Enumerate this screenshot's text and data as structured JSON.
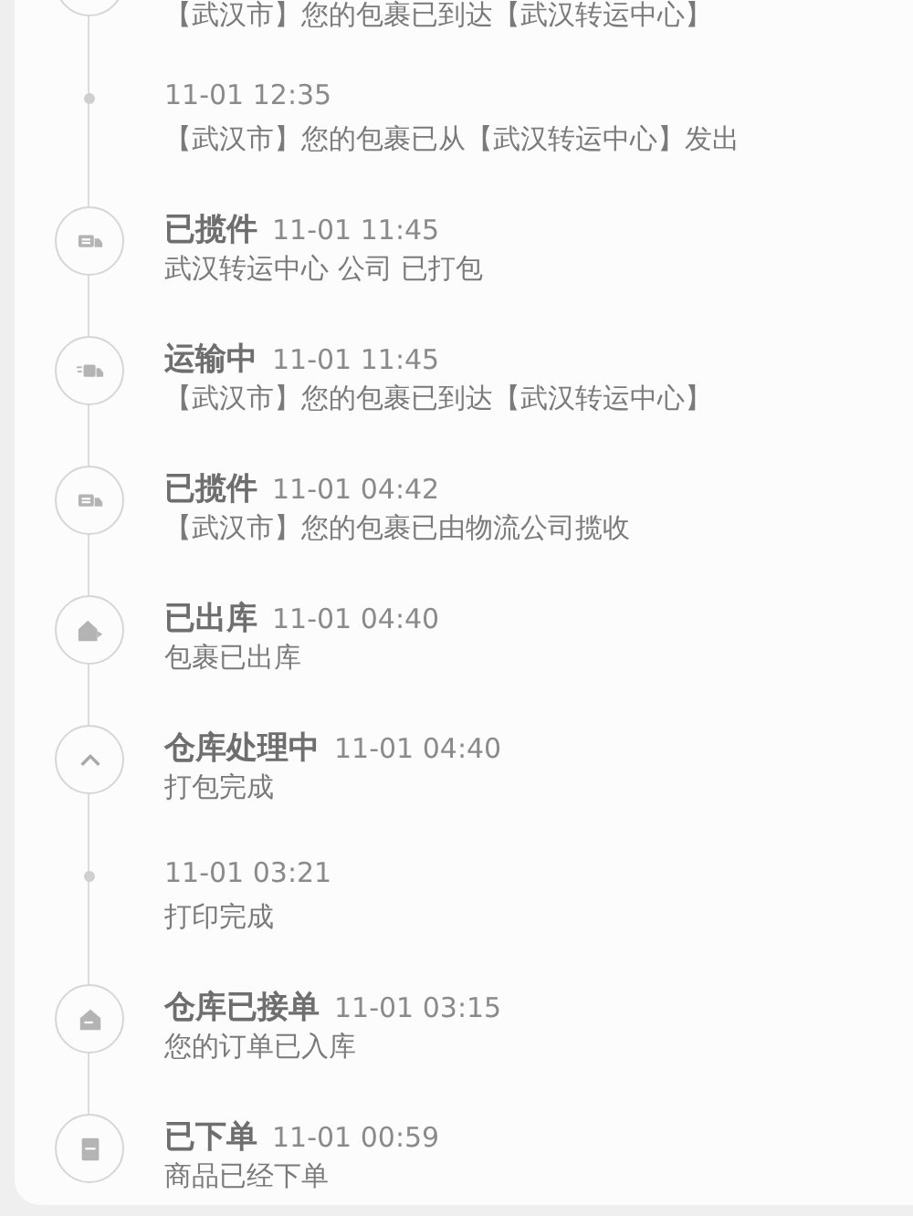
{
  "events": [
    {
      "kind": "cut",
      "description": "【武汉市】您的包裹已到达【武汉转运中心】"
    },
    {
      "kind": "update",
      "time": "11-01 12:35",
      "description": "【武汉市】您的包裹已从【武汉转运中心】发出"
    },
    {
      "kind": "collected",
      "title": "已揽件",
      "time": "11-01 11:45",
      "description": "武汉转运中心 公司 已打包"
    },
    {
      "kind": "in_transit",
      "title": "运输中",
      "time": "11-01 11:45",
      "description": "【武汉市】您的包裹已到达【武汉转运中心】"
    },
    {
      "kind": "collected",
      "title": "已揽件",
      "time": "11-01 04:42",
      "description": "【武汉市】您的包裹已由物流公司揽收"
    },
    {
      "kind": "dispatched",
      "title": "已出库",
      "time": "11-01 04:40",
      "description": "包裹已出库"
    },
    {
      "kind": "processing",
      "title": "仓库处理中",
      "time": "11-01 04:40",
      "description": "打包完成"
    },
    {
      "kind": "update",
      "time": "11-01 03:21",
      "description": "打印完成"
    },
    {
      "kind": "received",
      "title": "仓库已接单",
      "time": "11-01 03:15",
      "description": "您的订单已入库"
    },
    {
      "kind": "ordered",
      "title": "已下单",
      "time": "11-01 00:59",
      "description": "商品已经下单"
    }
  ]
}
